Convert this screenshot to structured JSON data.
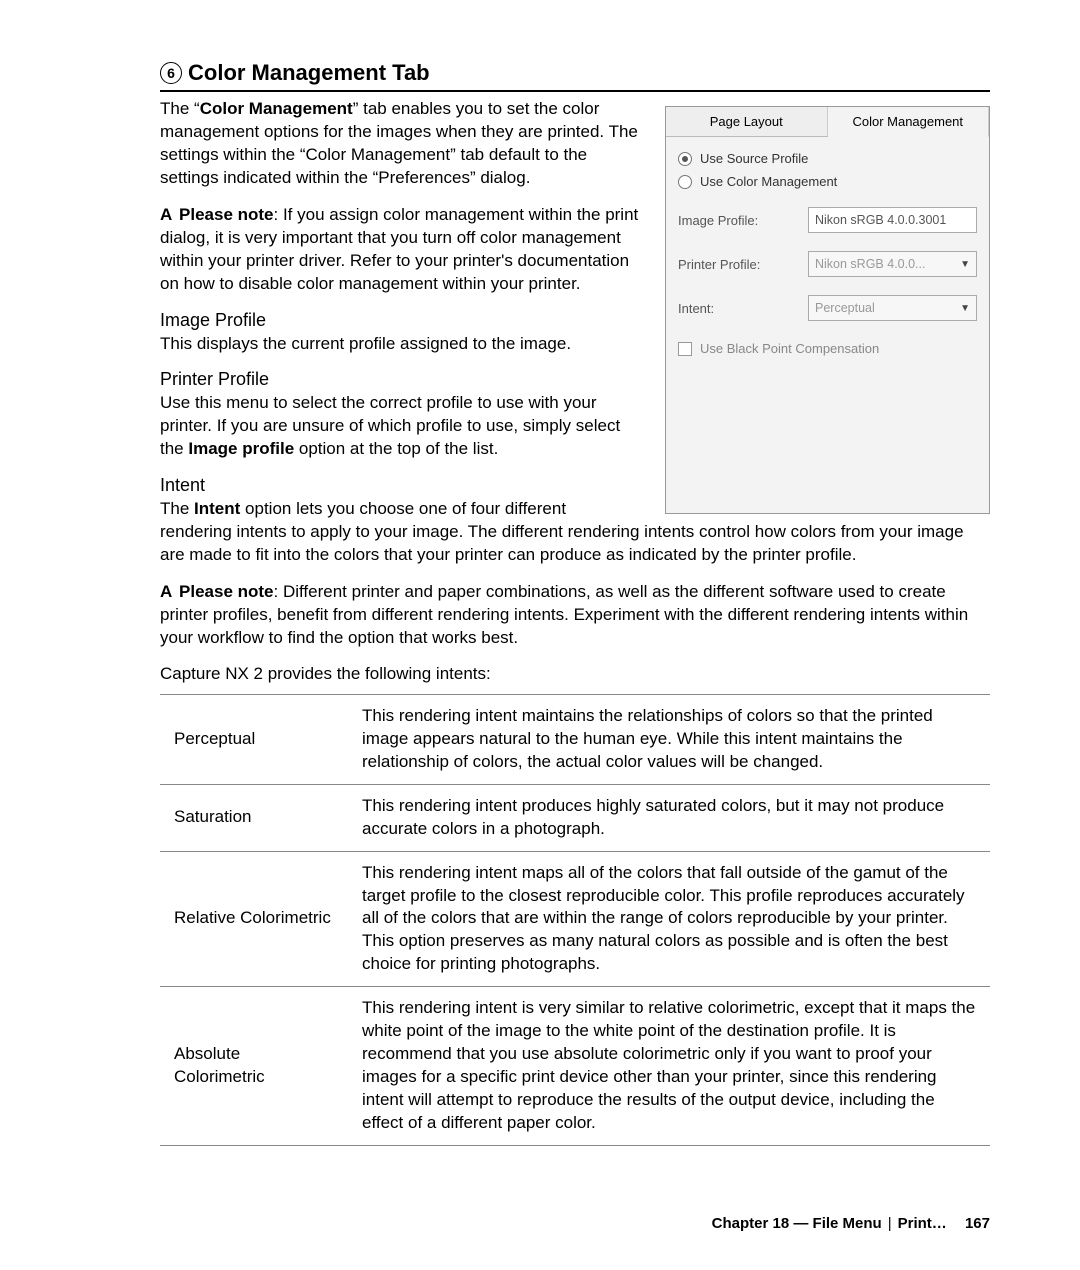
{
  "section": {
    "number": "6",
    "title": "Color Management Tab"
  },
  "intro": {
    "para1_pre": "The “",
    "para1_bold": "Color Management",
    "para1_post": "” tab enables you to set the color management options for the images when they are printed. The settings within the “Color Management” tab default to the settings indicated within the “Preferences” dialog.",
    "noteA_label": "Please note",
    "noteA_text": ": If you assign color management within the print dialog, it is very important that you turn off color management within your printer driver. Refer to your printer's documentation on how to disable color management within your printer."
  },
  "sub": {
    "image_profile_h": "Image Profile",
    "image_profile_t": "This displays the current profile assigned to the image.",
    "printer_profile_h": "Printer Profile",
    "printer_profile_t_pre": "Use this menu to select the correct profile to use with your printer. If you are unsure of which profile to use, simply select the ",
    "printer_profile_t_bold": "Image profile",
    "printer_profile_t_post": " option at the top of the list.",
    "intent_h": "Intent",
    "intent_t_pre": "The ",
    "intent_t_bold": "Intent",
    "intent_t_post": " option lets you choose one of four different rendering intents to apply to your image. The different rendering intents control how colors from your image are made to fit into the colors that your printer can produce as indicated by the printer profile.",
    "noteB_label": "Please note",
    "noteB_text": ": Different printer and paper combinations, as well as the different software used to create printer profiles, benefit from different rendering intents. Experiment with the different rendering intents within your workflow to find the option that works best.",
    "intents_intro": "Capture NX 2 provides the following intents:"
  },
  "dialog": {
    "tab1": "Page Layout",
    "tab2": "Color Management",
    "radio1": "Use Source Profile",
    "radio2": "Use Color Management",
    "label_image_profile": "Image Profile:",
    "value_image_profile": "Nikon sRGB 4.0.0.3001",
    "label_printer_profile": "Printer Profile:",
    "value_printer_profile": "Nikon sRGB 4.0.0...",
    "label_intent": "Intent:",
    "value_intent": "Perceptual",
    "chk_blackpoint": "Use Black Point Compensation"
  },
  "table": [
    {
      "name": "Perceptual",
      "desc": "This rendering intent maintains the relationships of colors so that the printed image appears natural to the human eye. While this intent maintains the relationship of colors, the actual color values will be changed."
    },
    {
      "name": "Saturation",
      "desc": "This rendering intent produces highly saturated colors, but it may not produce accurate colors in a photograph."
    },
    {
      "name": "Relative Colorimetric",
      "desc": "This rendering intent maps all of the colors that fall outside of the gamut of the target profile to the closest reproducible color. This profile reproduces accurately all of the colors that are within the range of colors reproducible by your printer. This option preserves as many natural colors as possible and is often the best choice for printing photographs."
    },
    {
      "name": "Absolute Colorimetric",
      "desc": "This rendering intent is very similar to relative colorimetric, except that it maps the white point of the image to the white point of the destination profile. It is recommend that you use absolute colorimetric only if you want to proof your images for a specific print device other than your printer, since this rendering intent will attempt to reproduce the results of the output device, including the effect of a different paper color."
    }
  ],
  "footer": {
    "chapter": "Chapter 18 — File Menu",
    "crumb": "Print…",
    "page": "167"
  }
}
